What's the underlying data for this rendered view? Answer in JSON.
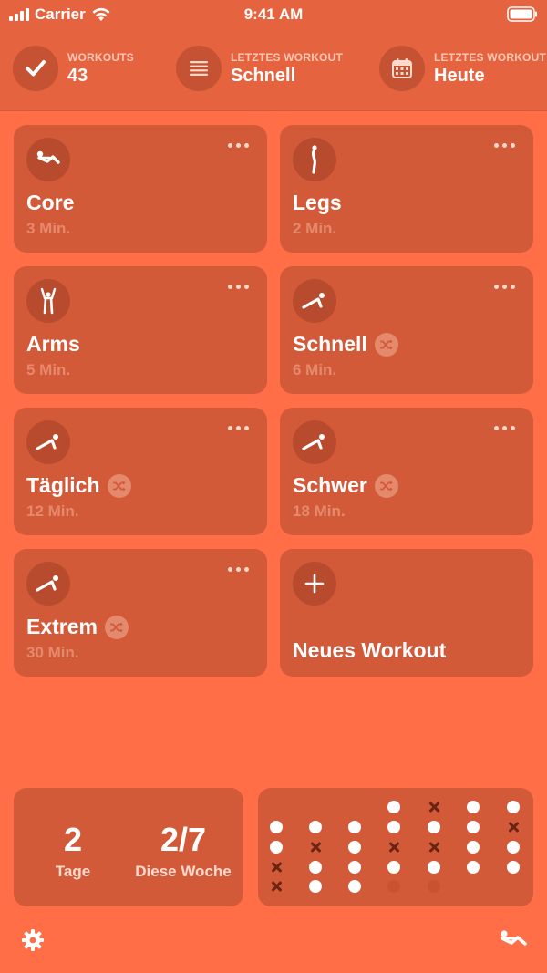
{
  "status": {
    "carrier": "Carrier",
    "time": "9:41 AM"
  },
  "header": {
    "workouts_label": "WORKOUTS",
    "workouts_value": "43",
    "last_label_1": "LETZTES WORKOUT",
    "last_value_1": "Schnell",
    "last_label_2": "LETZTES WORKOUT",
    "last_value_2": "Heute"
  },
  "cards": [
    {
      "title": "Core",
      "duration": "3 Min.",
      "icon": "situp-icon",
      "shuffle": false
    },
    {
      "title": "Legs",
      "duration": "2 Min.",
      "icon": "standing-figure-icon",
      "shuffle": false
    },
    {
      "title": "Arms",
      "duration": "5 Min.",
      "icon": "arms-raised-figure-icon",
      "shuffle": false
    },
    {
      "title": "Schnell",
      "duration": "6 Min.",
      "icon": "pushup-icon",
      "shuffle": true
    },
    {
      "title": "Täglich",
      "duration": "12 Min.",
      "icon": "pushup-icon",
      "shuffle": true
    },
    {
      "title": "Schwer",
      "duration": "18 Min.",
      "icon": "pushup-icon",
      "shuffle": true
    },
    {
      "title": "Extrem",
      "duration": "30 Min.",
      "icon": "pushup-icon",
      "shuffle": true
    }
  ],
  "new_workout": {
    "label": "Neues Workout",
    "icon": "plus-icon"
  },
  "summary": {
    "streak_value": "2",
    "streak_label": "Tage",
    "week_value": "2/7",
    "week_label": "Diese Woche"
  },
  "activity_grid": {
    "legend": "dot = workout day, cross = missed day",
    "columns": [
      [
        "",
        "dot",
        "dot",
        "cross",
        "cross"
      ],
      [
        "",
        "dot",
        "cross",
        "dot",
        "dot"
      ],
      [
        "",
        "dot",
        "dot",
        "dot",
        "dot"
      ],
      [
        "dot",
        "dot",
        "cross",
        "dot",
        "faint"
      ],
      [
        "cross",
        "dot",
        "cross",
        "dot",
        "faint"
      ],
      [
        "dot",
        "dot",
        "dot",
        "dot",
        ""
      ],
      [
        "dot",
        "cross",
        "dot",
        "dot",
        ""
      ]
    ]
  },
  "colors": {
    "background": "#FF6E47",
    "card": "#D35A39",
    "header": "#E6633F",
    "muted_text": "#E5896C"
  }
}
